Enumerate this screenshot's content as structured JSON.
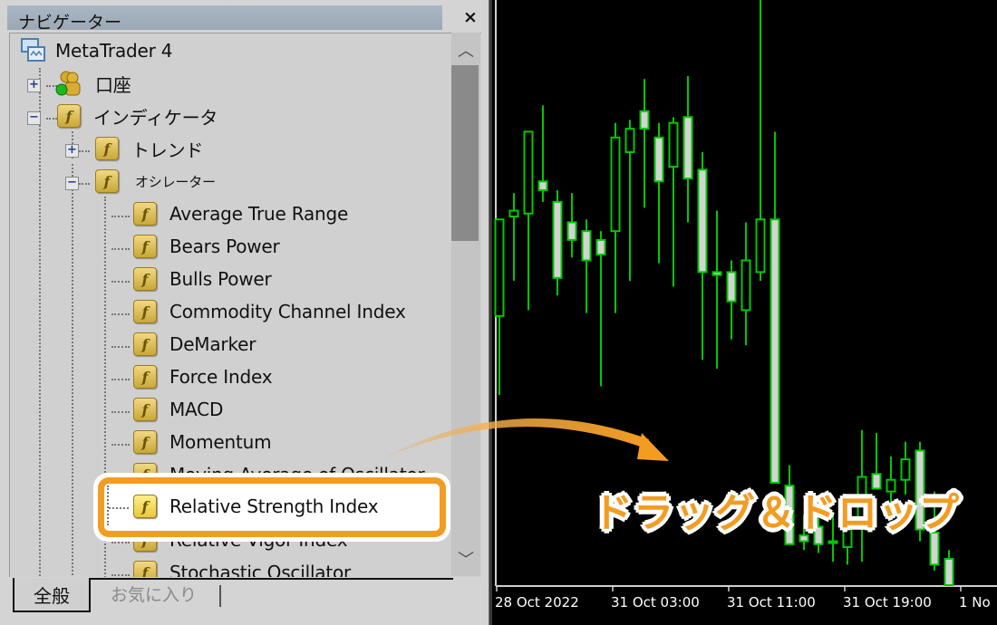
{
  "navigator": {
    "title": "ナビゲーター",
    "close_label": "×",
    "root": {
      "label": "MetaTrader 4",
      "icon": "terminal-icon"
    },
    "accounts": {
      "label": "口座",
      "icon": "accounts-icon",
      "expander": "+"
    },
    "indicators": {
      "label": "インディケータ",
      "icon": "indicator-folder-icon",
      "expander": "−"
    },
    "trend": {
      "label": "トレンド",
      "icon": "indicator-folder-icon",
      "expander": "+"
    },
    "oscillators": {
      "label": "オシレーター",
      "icon": "indicator-folder-icon",
      "expander": "−"
    },
    "oscillator_items": [
      {
        "label": "Average True Range"
      },
      {
        "label": "Bears Power"
      },
      {
        "label": "Bulls Power"
      },
      {
        "label": "Commodity Channel Index"
      },
      {
        "label": "DeMarker"
      },
      {
        "label": "Force Index"
      },
      {
        "label": "MACD"
      },
      {
        "label": "Momentum"
      },
      {
        "label": "Moving Average of Oscillator"
      },
      {
        "label": "Relative Strength Index",
        "highlighted": true
      },
      {
        "label": "Relative Vigor Index"
      },
      {
        "label": "Stochastic Oscillator"
      }
    ],
    "function_icon_glyph": "f",
    "scroll_up": "︿",
    "scroll_down": "﹀",
    "tabs": [
      {
        "label": "全般",
        "active": true
      },
      {
        "label": "お気に入り",
        "active": false
      }
    ]
  },
  "annotation": {
    "text": "ドラッグ＆ドロップ",
    "color": "#f39c22"
  },
  "chart": {
    "background": "#000000",
    "bull_fill": "#000000",
    "bear_fill": "#d3d3d3",
    "candle_outline": "#00c800",
    "x_ticks": [
      "28 Oct 2022",
      "31 Oct 03:00",
      "31 Oct 11:00",
      "31 Oct 19:00",
      "1 No"
    ]
  },
  "chart_data": {
    "type": "candlestick",
    "title": "",
    "xlabel": "",
    "ylabel": "",
    "price_units": "relative (0 = bottom of visible chart, 100 = top); no price axis visible",
    "x_tick_labels": [
      "28 Oct 2022",
      "31 Oct 03:00",
      "31 Oct 11:00",
      "31 Oct 19:00",
      "1 No"
    ],
    "candles": [
      {
        "o": 46.0,
        "h": 53.5,
        "l": 32.5,
        "c": 62.5
      },
      {
        "o": 63.0,
        "h": 67.0,
        "l": 52.0,
        "c": 64.0
      },
      {
        "o": 63.5,
        "h": 75.5,
        "l": 47.0,
        "c": 77.5
      },
      {
        "o": 69.0,
        "h": 82.0,
        "l": 65.5,
        "c": 67.5
      },
      {
        "o": 65.5,
        "h": 67.5,
        "l": 49.5,
        "c": 52.5
      },
      {
        "o": 62.0,
        "h": 67.0,
        "l": 56.0,
        "c": 59.0
      },
      {
        "o": 60.5,
        "h": 62.5,
        "l": 46.5,
        "c": 55.5
      },
      {
        "o": 59.0,
        "h": 60.5,
        "l": 34.0,
        "c": 56.5
      },
      {
        "o": 60.5,
        "h": 79.0,
        "l": 46.5,
        "c": 76.5
      },
      {
        "o": 74.0,
        "h": 79.5,
        "l": 52.0,
        "c": 78.0
      },
      {
        "o": 81.0,
        "h": 86.5,
        "l": 64.5,
        "c": 78.0
      },
      {
        "o": 76.5,
        "h": 79.0,
        "l": 55.0,
        "c": 69.0
      },
      {
        "o": 71.5,
        "h": 80.0,
        "l": 51.0,
        "c": 79.0
      },
      {
        "o": 80.0,
        "h": 87.0,
        "l": 62.0,
        "c": 69.5
      },
      {
        "o": 71.0,
        "h": 74.0,
        "l": 38.5,
        "c": 53.5
      },
      {
        "o": 53.5,
        "h": 64.0,
        "l": 37.0,
        "c": 53.0
      },
      {
        "o": 53.5,
        "h": 55.5,
        "l": 42.0,
        "c": 48.5
      },
      {
        "o": 47.0,
        "h": 62.0,
        "l": 41.0,
        "c": 55.5
      },
      {
        "o": 53.5,
        "h": 100.0,
        "l": 52.0,
        "c": 62.5
      },
      {
        "o": 62.5,
        "h": 77.5,
        "l": 19.0,
        "c": 17.5
      },
      {
        "o": 17.0,
        "h": 20.5,
        "l": 7.5,
        "c": 7.0
      },
      {
        "o": 8.5,
        "h": 12.0,
        "l": 6.0,
        "c": 7.5
      },
      {
        "o": 10.0,
        "h": 13.5,
        "l": 5.5,
        "c": 7.0
      },
      {
        "o": 7.5,
        "h": 12.5,
        "l": 4.0,
        "c": 7.5
      },
      {
        "o": 6.5,
        "h": 13.0,
        "l": 3.5,
        "c": 11.5
      },
      {
        "o": 11.0,
        "h": 26.5,
        "l": 4.0,
        "c": 18.5
      },
      {
        "o": 19.0,
        "h": 26.0,
        "l": 16.5,
        "c": 16.5
      },
      {
        "o": 16.0,
        "h": 22.0,
        "l": 12.0,
        "c": 18.0
      },
      {
        "o": 18.0,
        "h": 24.5,
        "l": 15.5,
        "c": 21.5
      },
      {
        "o": 23.0,
        "h": 24.5,
        "l": 7.5,
        "c": 9.5
      },
      {
        "o": 9.0,
        "h": 16.0,
        "l": 2.5,
        "c": 3.5
      },
      {
        "o": 4.5,
        "h": 6.0,
        "l": 0.0,
        "c": 0.0
      }
    ]
  }
}
